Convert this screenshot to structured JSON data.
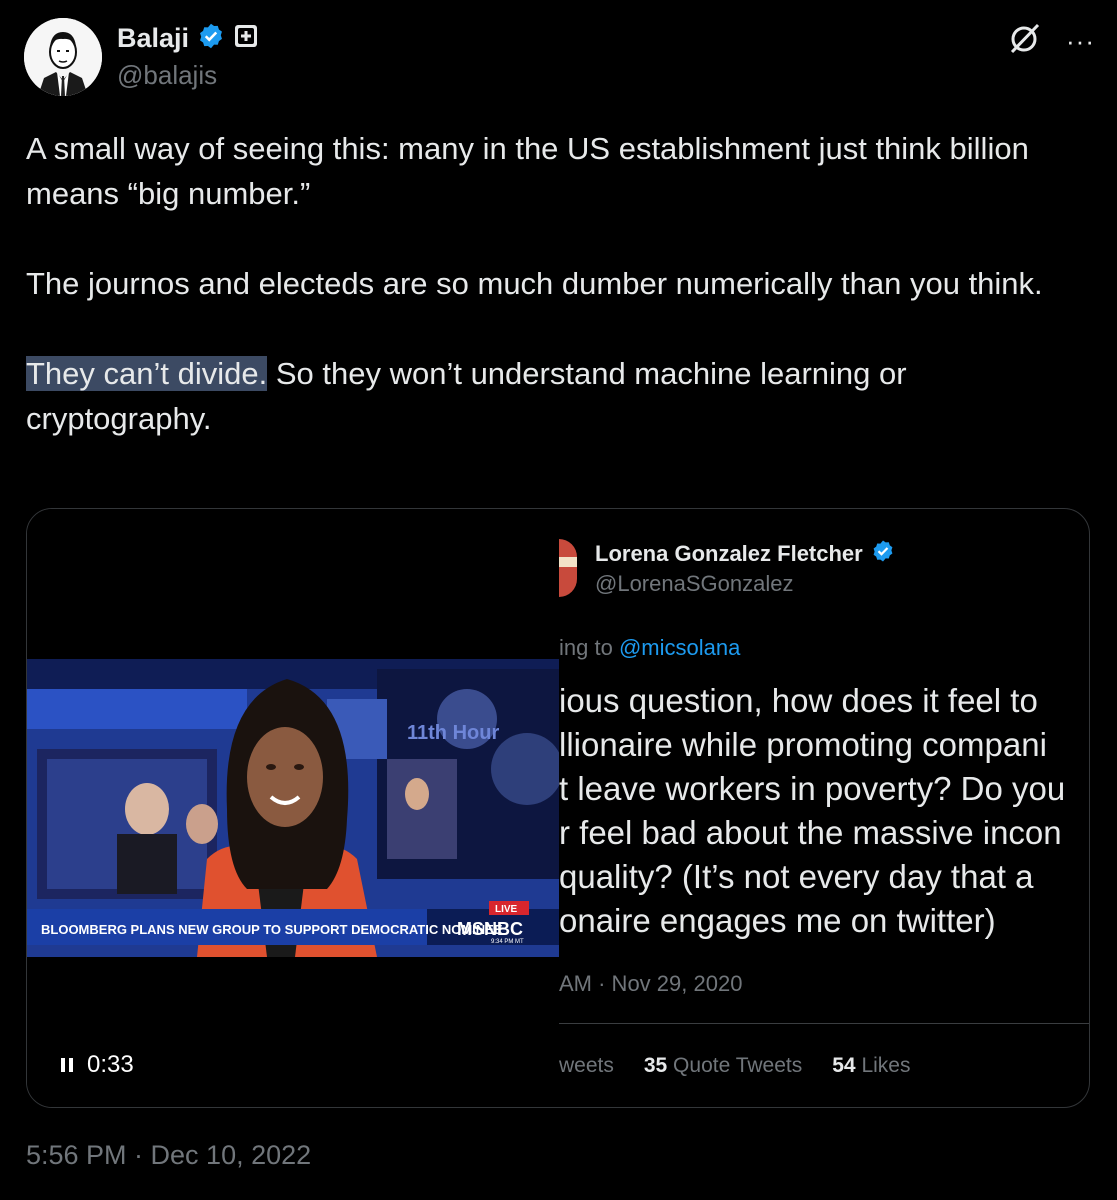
{
  "author": {
    "name": "Balaji",
    "handle": "@balajis"
  },
  "tweet": {
    "paragraph_1": "A small way of seeing this: many in the US establishment just think billion means “big number.”",
    "paragraph_2": "The journos and electeds are so much dumber numerically than you think.",
    "paragraph_3_highlight": "They can’t divide.",
    "paragraph_3_rest": " So they won’t understand machine learning or cryptography."
  },
  "video": {
    "chyron": "BLOOMBERG PLANS NEW GROUP TO SUPPORT DEMOCRATIC NOMINEE",
    "network": "MSNBC",
    "live_label": "LIVE",
    "clock": "9:34 PM MT",
    "show_logo": "11th Hour",
    "elapsed": "0:33"
  },
  "quoted_tweet": {
    "name": "Lorena Gonzalez Fletcher",
    "handle": "@LorenaSGonzalez",
    "reply_prefix": "ing to ",
    "reply_mention": "@micsolana",
    "lines": [
      "ious question, how does it feel to",
      "llionaire while promoting compani",
      "t leave workers in poverty? Do you",
      "r feel bad about the massive incon",
      "quality? (It’s not every day that a",
      "onaire engages me on twitter)"
    ],
    "timestamp": "AM · Nov 29, 2020",
    "retweets_label": "weets",
    "quote_count": "35",
    "quote_label": " Quote Tweets",
    "likes_count": "54",
    "likes_label": " Likes"
  },
  "footer": {
    "timestamp": "5:56 PM · Dec 10, 2022"
  },
  "colors": {
    "background": "#000000",
    "text": "#e7e9ea",
    "muted": "#71767b",
    "link": "#1d9bf0",
    "verified": "#1d9bf0",
    "highlight": "#3c4a63",
    "msnbc_live": "#d8262d",
    "chyron_bg": "#1b3fa6"
  },
  "icons": [
    "verified-badge-icon",
    "affiliate-badge-icon",
    "grok-icon",
    "more-icon",
    "pause-icon"
  ]
}
